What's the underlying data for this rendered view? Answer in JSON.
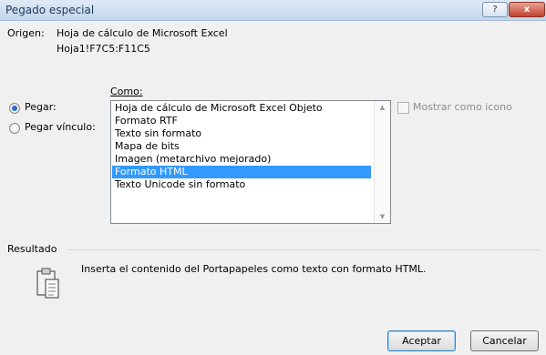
{
  "dialog": {
    "title": "Pegado especial",
    "help_label": "?",
    "close_label": "x"
  },
  "origin": {
    "label": "Origen:",
    "source": "Hoja de cálculo de Microsoft Excel",
    "range": "Hoja1!F7C5:F11C5"
  },
  "paste_mode": {
    "paste_label": "Pegar:",
    "paste_selected": true,
    "link_label": "Pegar vínculo:",
    "link_selected": false
  },
  "como": {
    "label": "Como:",
    "items": [
      "Hoja de cálculo de Microsoft Excel Objeto",
      "Formato RTF",
      "Texto sin formato",
      "Mapa de bits",
      "Imagen (metarchivo mejorado)",
      "Formato HTML",
      "Texto Unicode sin formato"
    ],
    "selected_index": 5
  },
  "show_icon": {
    "label": "Mostrar como icono",
    "checked": false,
    "enabled": false
  },
  "result": {
    "label": "Resultado",
    "text": "Inserta el contenido del Portapapeles como texto con formato HTML.",
    "icon": "clipboard-icon"
  },
  "buttons": {
    "ok": "Aceptar",
    "cancel": "Cancelar"
  }
}
